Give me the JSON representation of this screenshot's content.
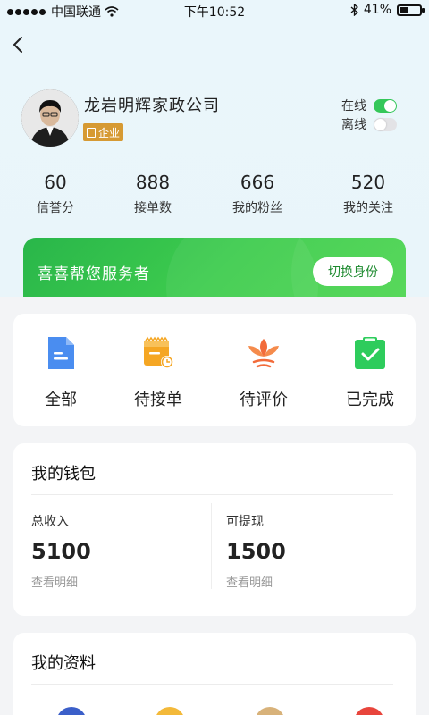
{
  "status_bar": {
    "carrier": "中国联通",
    "time": "下午10:52",
    "battery": "41%",
    "battery_level": 0.41,
    "icons": [
      "signal-dots-icon",
      "wifi-icon",
      "bluetooth-icon",
      "battery-icon"
    ]
  },
  "header": {
    "back_icon": "chevron-left-icon",
    "company_name": "龙岩明辉家政公司",
    "badge_label": "企业",
    "online_label": "在线",
    "online_on": true,
    "offline_label": "离线",
    "offline_on": false
  },
  "stats": [
    {
      "value": "60",
      "label": "信誉分"
    },
    {
      "value": "888",
      "label": "接单数"
    },
    {
      "value": "666",
      "label": "我的粉丝"
    },
    {
      "value": "520",
      "label": "我的关注"
    }
  ],
  "role_card": {
    "text": "喜喜帮您服务者",
    "switch_label": "切换身份"
  },
  "orders": [
    {
      "label": "全部",
      "icon": "document-icon"
    },
    {
      "label": "待接单",
      "icon": "calendar-clock-icon"
    },
    {
      "label": "待评价",
      "icon": "lotus-icon"
    },
    {
      "label": "已完成",
      "icon": "clipboard-check-icon"
    }
  ],
  "wallet": {
    "title": "我的钱包",
    "total_label": "总收入",
    "total_value": "5100",
    "total_link": "查看明细",
    "withdraw_label": "可提现",
    "withdraw_value": "1500",
    "withdraw_link": "查看明细"
  },
  "profile": {
    "title": "我的资料"
  },
  "colors": {
    "accent_green": "#34c759",
    "badge_gold": "#d69a33",
    "card_green": "#3fcd4e"
  }
}
